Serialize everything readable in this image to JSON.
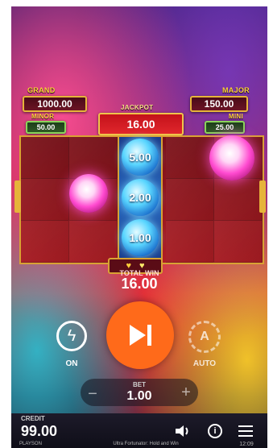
{
  "jackpots": {
    "grand": {
      "label": "GRAND",
      "value": "1000.00"
    },
    "major": {
      "label": "MAJOR",
      "value": "150.00"
    },
    "minor": {
      "label": "MINOR",
      "value": "50.00"
    },
    "mini": {
      "label": "MINI",
      "value": "25.00"
    },
    "center": {
      "label": "JACKPOT",
      "value": "16.00"
    }
  },
  "reel": {
    "orb_values": [
      "5.00",
      "2.00",
      "1.00"
    ]
  },
  "win": {
    "label": "TOTAL WIN",
    "value": "16.00"
  },
  "controls": {
    "turbo_label": "ON",
    "auto_label": "AUTO",
    "bet_label": "BET",
    "bet_value": "1.00",
    "minus": "−",
    "plus": "+"
  },
  "footer": {
    "credit_label": "CREDIT",
    "credit_value": "99.00",
    "brand": "PLAYSON",
    "game_title": "Ultra Fortunator: Hold and Win",
    "time": "12:09"
  },
  "colors": {
    "accent": "#ff6a1a",
    "gold": "#e6b43a"
  }
}
